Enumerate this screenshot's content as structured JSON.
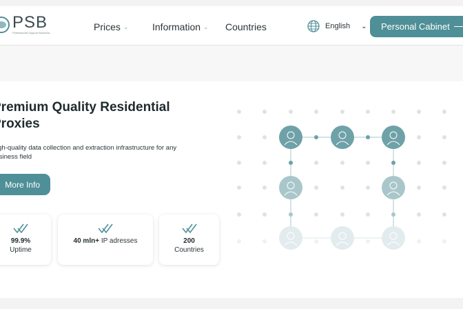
{
  "header": {
    "logo_name": "PSB",
    "logo_sub": "Professional Support Business",
    "nav": [
      {
        "label": "Prices",
        "chevron": true
      },
      {
        "label": "Information",
        "chevron": true
      },
      {
        "label": "Countries",
        "chevron": false
      }
    ],
    "language": "English",
    "cabinet_label": "Personal Cabinet"
  },
  "hero": {
    "title": "Premium Quality Residential Proxies",
    "subtitle": "High-quality data collection and extraction infrastructure for any business field",
    "cta_label": "More Info",
    "stats": [
      {
        "value": "99.9%",
        "label": "Uptime"
      },
      {
        "value": "40 mln+",
        "label": "IP adresses"
      },
      {
        "value": "200",
        "label": "Countries"
      }
    ]
  },
  "colors": {
    "accent": "#4f8f97",
    "node_dark": "#6fa1a8",
    "node_light": "#a9c7cb",
    "dot": "#dde3e4"
  }
}
